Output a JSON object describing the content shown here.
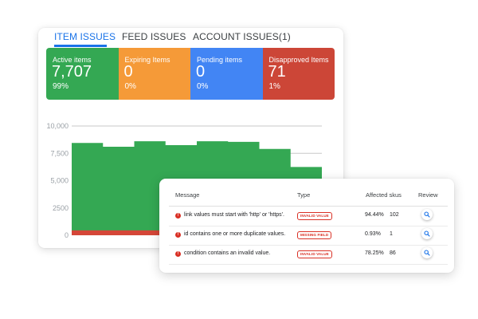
{
  "tabs": [
    {
      "label": "ITEM ISSUES",
      "active": true
    },
    {
      "label": "FEED ISSUES",
      "active": false
    },
    {
      "label": "ACCOUNT ISSUES(1)",
      "active": false
    }
  ],
  "tiles": [
    {
      "label": "Active items",
      "count": "7,707",
      "percent": "99%",
      "color": "#34a853"
    },
    {
      "label": "Expiring Items",
      "count": "0",
      "percent": "0%",
      "color": "#f59a38"
    },
    {
      "label": "Pending items",
      "count": "0",
      "percent": "0%",
      "color": "#4285f4"
    },
    {
      "label": "Disapproved Items",
      "count": "71",
      "percent": "1%",
      "color": "#cc4637"
    }
  ],
  "chart_data": {
    "type": "area",
    "title": "",
    "xlabel": "",
    "ylabel": "",
    "ylim": [
      0,
      10000
    ],
    "yticks": [
      "0",
      "2500",
      "5,000",
      "7,500",
      "10,000"
    ],
    "ytick_values": [
      0,
      2500,
      5000,
      7500,
      10000
    ],
    "grid": true,
    "x": [
      0,
      1,
      2,
      3,
      4,
      5,
      6,
      7,
      8
    ],
    "series": [
      {
        "values": [
          8450,
          8100,
          8600,
          8250,
          8600,
          8550,
          7900,
          6250,
          6250
        ],
        "color": "#34a853"
      },
      {
        "values": [
          450,
          450,
          450,
          450,
          450,
          450,
          450,
          450,
          450
        ],
        "color": "#d44638"
      }
    ]
  },
  "issues": {
    "columns": {
      "message": "Message",
      "type": "Type",
      "affected": "Affected skus",
      "review": "Review"
    },
    "rows": [
      {
        "message": "link values must start with 'http' or 'https'.",
        "type": "INVALID VALUE",
        "percent": "94.44%",
        "count": "102"
      },
      {
        "message": "id contains one or more duplicate values.",
        "type": "MISSING FIELD",
        "percent": "0.93%",
        "count": "1"
      },
      {
        "message": "condition contains an invalid value.",
        "type": "INVALID VALUE",
        "percent": "78.25%",
        "count": "86"
      }
    ]
  },
  "icons": {
    "error": "error-icon",
    "review": "search-icon"
  },
  "colors": {
    "accent": "#1a73e8",
    "error": "#d93025"
  }
}
